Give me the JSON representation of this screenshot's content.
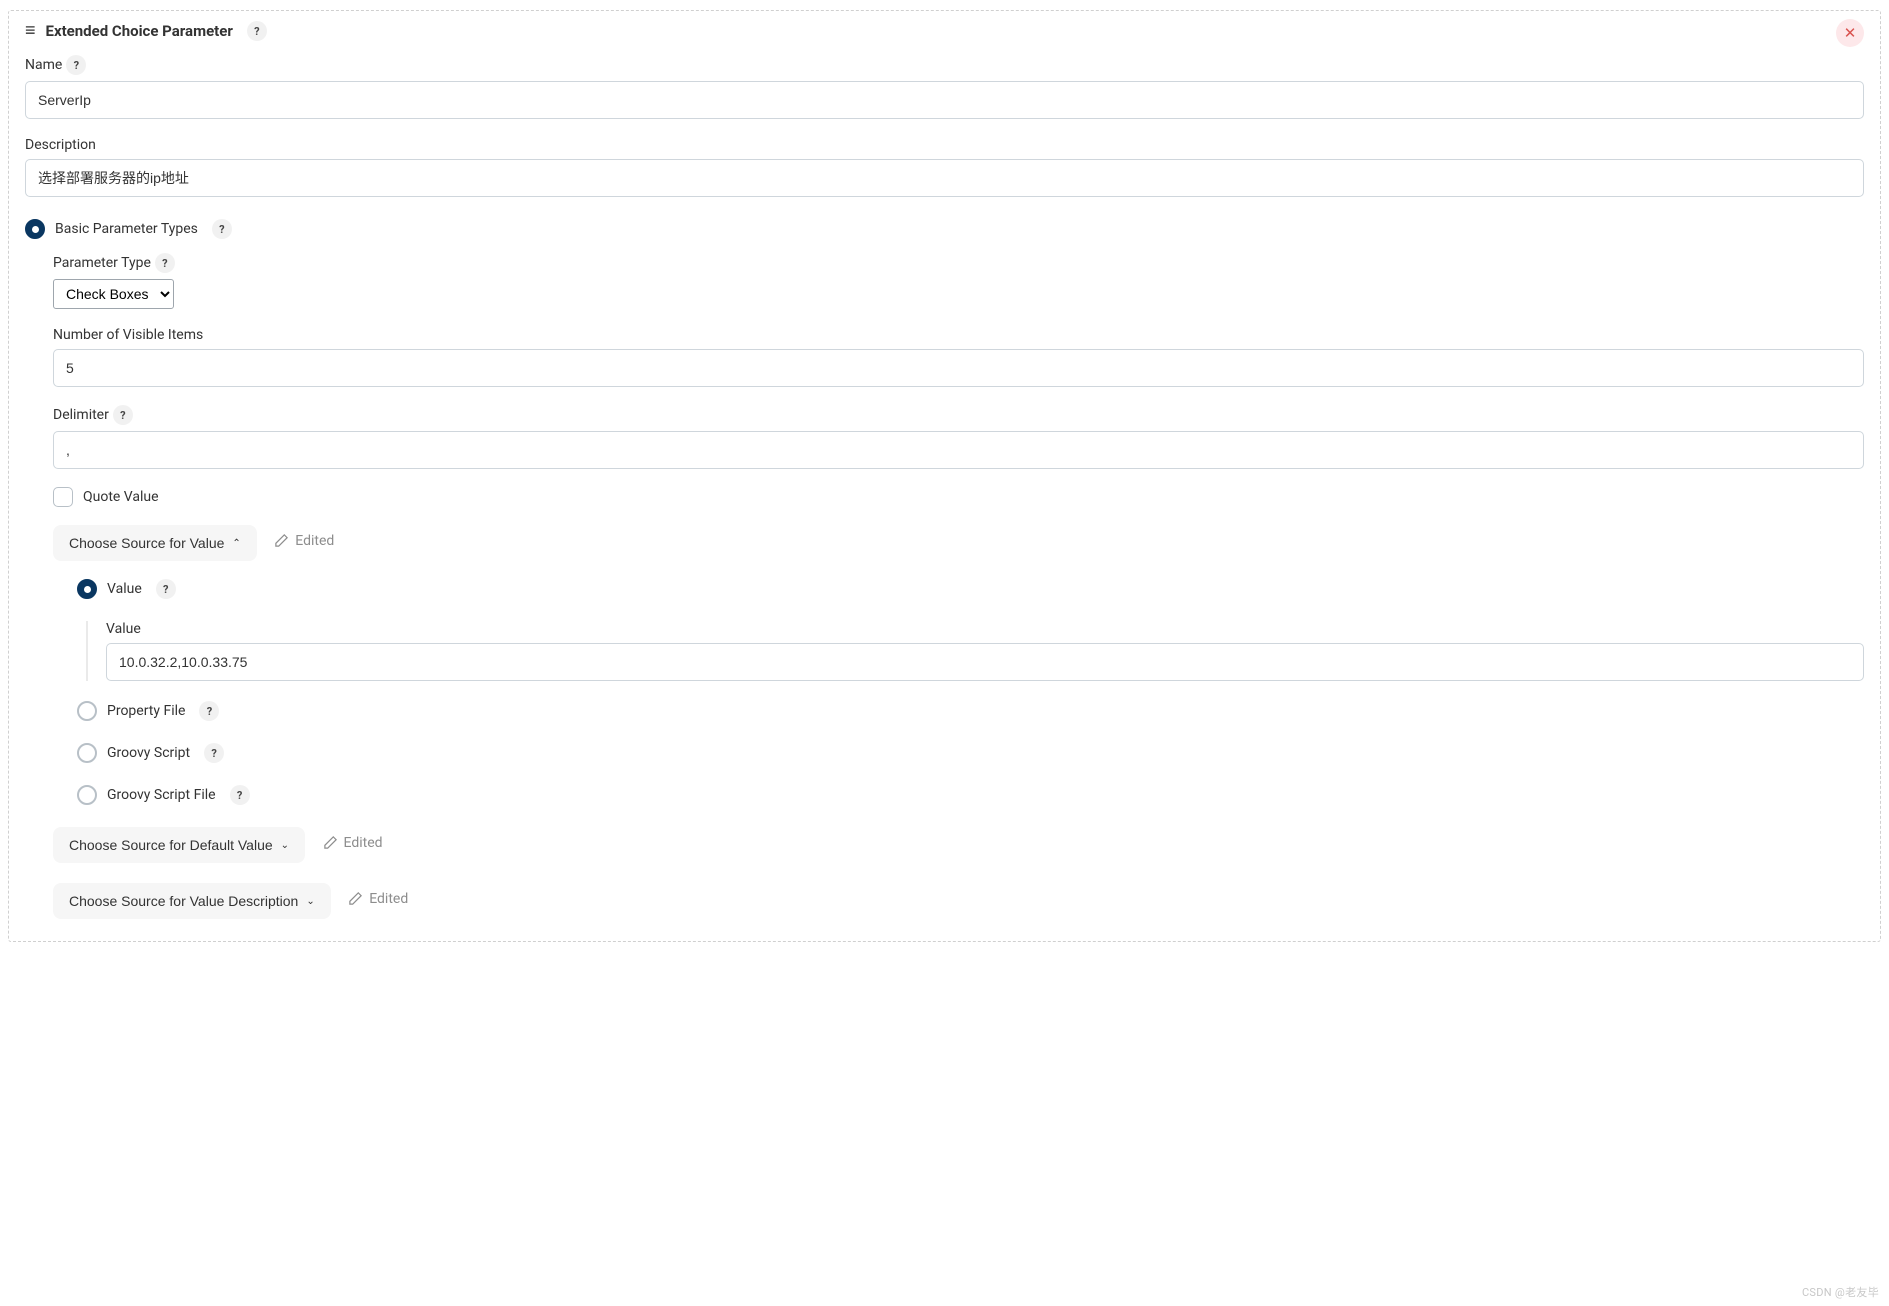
{
  "header": {
    "title": "Extended Choice Parameter",
    "help": "?",
    "close": "✕",
    "drag": "≡"
  },
  "fields": {
    "name_label": "Name",
    "name_value": "ServerIp",
    "description_label": "Description",
    "description_value": "选择部署服务器的ip地址"
  },
  "basic_types": {
    "label": "Basic Parameter Types",
    "parameter_type_label": "Parameter Type",
    "parameter_type_value": "Check Boxes",
    "visible_items_label": "Number of Visible Items",
    "visible_items_value": "5",
    "delimiter_label": "Delimiter",
    "delimiter_value": ",",
    "quote_value_label": "Quote Value"
  },
  "source_value": {
    "button": "Choose Source for Value",
    "edited": "Edited",
    "options": {
      "value": "Value",
      "value_field_label": "Value",
      "value_field_value": "10.0.32.2,10.0.33.75",
      "property_file": "Property File",
      "groovy_script": "Groovy Script",
      "groovy_script_file": "Groovy Script File"
    }
  },
  "source_default": {
    "button": "Choose Source for Default Value",
    "edited": "Edited"
  },
  "source_description": {
    "button": "Choose Source for Value Description",
    "edited": "Edited"
  },
  "watermark": "CSDN @老友毕"
}
